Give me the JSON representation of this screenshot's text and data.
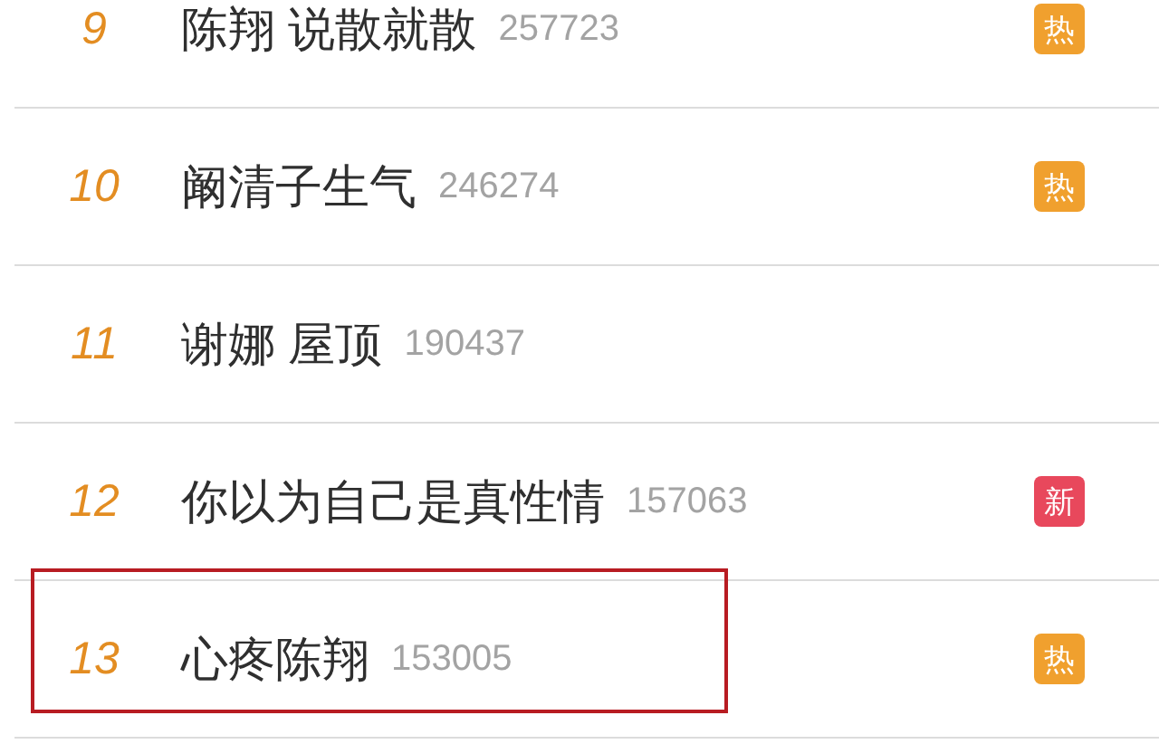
{
  "hot_search_list": [
    {
      "rank": "9",
      "title": "陈翔 说散就散",
      "count": "257723",
      "badge": {
        "kind": "hot",
        "label": "热"
      },
      "highlighted": false
    },
    {
      "rank": "10",
      "title": "阚清子生气",
      "count": "246274",
      "badge": {
        "kind": "hot",
        "label": "热"
      },
      "highlighted": false
    },
    {
      "rank": "11",
      "title": "谢娜 屋顶",
      "count": "190437",
      "highlighted": false
    },
    {
      "rank": "12",
      "title": "你以为自己是真性情",
      "count": "157063",
      "badge": {
        "kind": "new",
        "label": "新"
      },
      "highlighted": false
    },
    {
      "rank": "13",
      "title": "心疼陈翔",
      "count": "153005",
      "badge": {
        "kind": "hot",
        "label": "热"
      },
      "highlighted": true
    }
  ]
}
